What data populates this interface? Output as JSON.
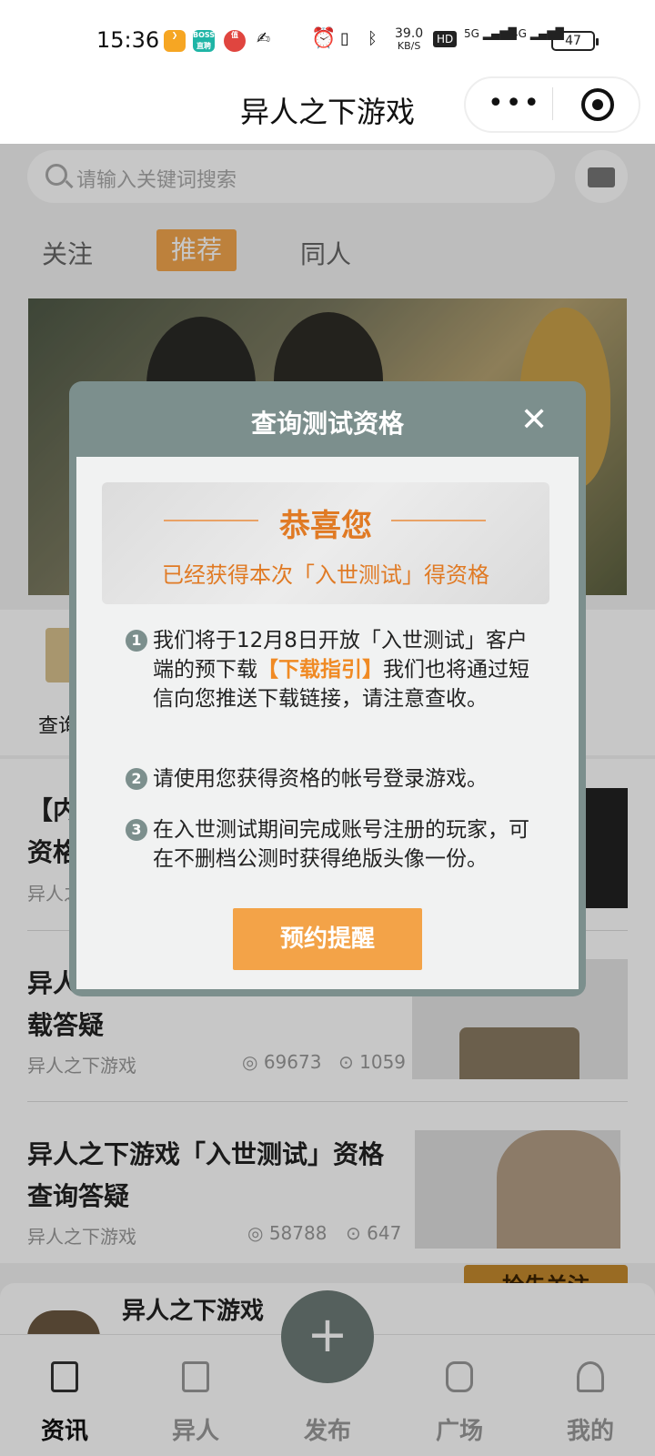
{
  "status_bar": {
    "time": "15:36",
    "boss_badge": "BOSS\n直聘",
    "data_speed": "39.0",
    "data_speed_unit": "KB/S",
    "hd_label": "HD",
    "net_5g": "5G",
    "net_4g": "4G",
    "battery": "47"
  },
  "title_bar": {
    "title": "异人之下游戏"
  },
  "search": {
    "placeholder": "请输入关键词搜索"
  },
  "tabs": [
    {
      "label": "关注"
    },
    {
      "label": "推荐",
      "active": true
    },
    {
      "label": "同人"
    }
  ],
  "quick_entry": {
    "label": "查询"
  },
  "articles": [
    {
      "title_1": "【内",
      "title_2": "资格",
      "author": "异人之"
    },
    {
      "title_1": "异人",
      "title_2": "载答疑",
      "author": "异人之下游戏",
      "views": "69673",
      "comments": "1059"
    },
    {
      "title_1": "异人之下游戏「入世测试」资格",
      "title_2": "查询答疑",
      "author": "异人之下游戏",
      "views": "58788",
      "comments": "647"
    }
  ],
  "follow_banner": "抢先关注",
  "account": {
    "name": "异人之下游戏"
  },
  "bottom_nav": [
    {
      "label": "资讯",
      "active": true
    },
    {
      "label": "异人"
    },
    {
      "label": "发布"
    },
    {
      "label": "广场"
    },
    {
      "label": "我的"
    }
  ],
  "modal": {
    "title": "查询测试资格",
    "close": "✕",
    "congrats_title": "恭喜您",
    "congrats_sub": "已经获得本次「入世测试」得资格",
    "items": [
      {
        "num": "1",
        "text_pre": "我们将于12月8日开放「入世测试」客户端的预下载",
        "link": "【下载指引】",
        "text_post": "我们也将通过短信向您推送下载链接，请注意查收。"
      },
      {
        "num": "2",
        "text": "请使用您获得资格的帐号登录游戏。"
      },
      {
        "num": "3",
        "text": "在入世测试期间完成账号注册的玩家，可在不删档公测时获得绝版头像一份。"
      }
    ],
    "button": "预约提醒"
  },
  "colors": {
    "accent": "#f3a348",
    "modal_header": "#7c8f8d",
    "congrats_text": "#e07a24"
  }
}
